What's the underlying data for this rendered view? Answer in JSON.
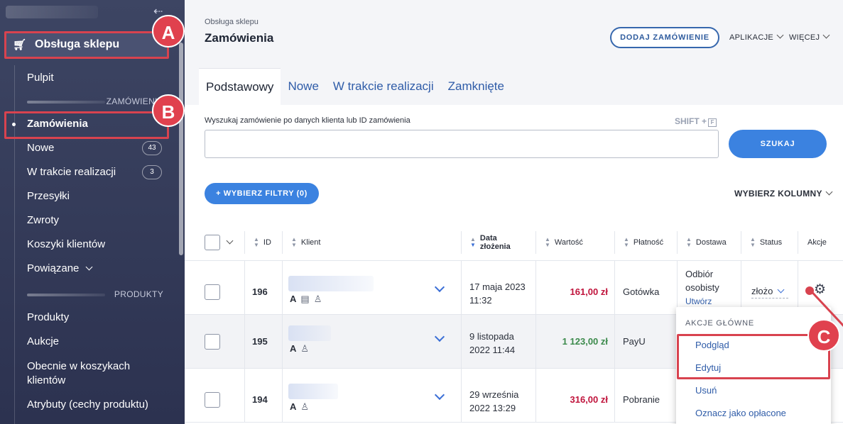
{
  "sidebar": {
    "shop_label": "Obsługa sklepu",
    "items": [
      {
        "label": "Pulpit"
      },
      {
        "label": "Zamówienia"
      },
      {
        "label": "Nowe",
        "count": "43"
      },
      {
        "label": "W trakcie realizacji",
        "count": "3"
      },
      {
        "label": "Przesyłki"
      },
      {
        "label": "Zwroty"
      },
      {
        "label": "Koszyki klientów"
      },
      {
        "label": "Powiązane"
      },
      {
        "label": "Produkty"
      },
      {
        "label": "Aukcje"
      },
      {
        "label": "Obecnie w koszykach klientów"
      },
      {
        "label": "Atrybuty (cechy produktu)"
      }
    ],
    "section_orders": "ZAMÓWIENIA",
    "section_products": "PRODUKTY"
  },
  "header": {
    "breadcrumb": "Obsługa sklepu",
    "title": "Zamówienia",
    "add_button": "DODAJ ZAMÓWIENIE",
    "apps_menu": "APLIKACJE",
    "more_menu": "WIĘCEJ"
  },
  "tabs": [
    "Podstawowy",
    "Nowe",
    "W trakcie realizacji",
    "Zamknięte"
  ],
  "search": {
    "label": "Wyszukaj zamówienie po danych klienta lub ID zamówienia",
    "shortcut": "SHIFT +",
    "shortcut_key": "F",
    "placeholder": "",
    "button": "SZUKAJ"
  },
  "filters_button": "+ WYBIERZ FILTRY (0)",
  "columns_menu": "WYBIERZ KOLUMNY",
  "table": {
    "headers": {
      "id": "ID",
      "client": "Klient",
      "date": "Data złożenia",
      "value": "Wartość",
      "payment": "Płatność",
      "delivery": "Dostawa",
      "status": "Status",
      "actions": "Akcje"
    },
    "rows": [
      {
        "id": "196",
        "date": "17 maja 2023",
        "time": "11:32",
        "value": "161,00 zł",
        "payment": "Gotówka",
        "delivery": "Odbiór osobisty",
        "delivery_link": "Utwórz",
        "status": "złożo"
      },
      {
        "id": "195",
        "date": "9 listopada",
        "time": "2022 11:44",
        "value": "1 123,00 zł",
        "payment": "PayU"
      },
      {
        "id": "194",
        "date": "29 września",
        "time": "2022 13:29",
        "value": "316,00 zł",
        "payment": "Pobranie"
      }
    ]
  },
  "actions_menu": {
    "heading": "AKCJE GŁÓWNE",
    "items": [
      "Podgląd",
      "Edytuj",
      "Usuń",
      "Oznacz jako opłacone"
    ]
  },
  "markers": {
    "a": "A",
    "b": "B",
    "c": "C"
  },
  "colors": {
    "accent": "#3b82e0",
    "highlight": "#d8434f",
    "sidebar": "#3d4563"
  }
}
